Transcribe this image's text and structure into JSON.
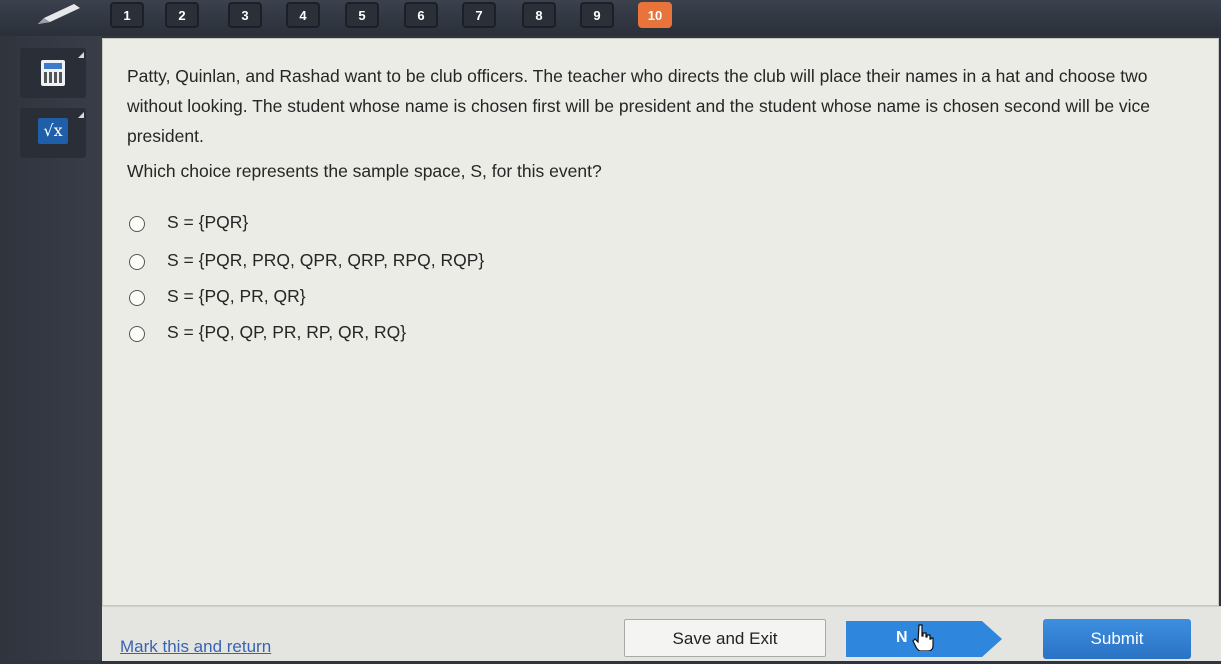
{
  "nav": {
    "questions": [
      "1",
      "2",
      "3",
      "4",
      "5",
      "6",
      "7",
      "8",
      "9",
      "10"
    ],
    "current_index": 9
  },
  "question": {
    "text": "Patty, Quinlan, and Rashad want to be club officers. The teacher who directs the club will place their names in a hat and choose two without looking. The student whose name is chosen first will be president and the student whose name is chosen second will be vice president.",
    "prompt": "Which choice represents the sample space, S, for this event?",
    "choices": [
      "S = {PQR}",
      "S = {PQR, PRQ, QPR, QRP, RPQ, RQP}",
      "S = {PQ, PR, QR}",
      "S = {PQ, QP, PR, RP, QR, RQ}"
    ]
  },
  "footer": {
    "mark_label": "Mark this and return",
    "save_label": "Save and Exit",
    "next_label": "N",
    "submit_label": "Submit"
  },
  "colors": {
    "current_question": "#e8743b",
    "submit": "#2f7fd6",
    "next": "#2f86dd"
  }
}
